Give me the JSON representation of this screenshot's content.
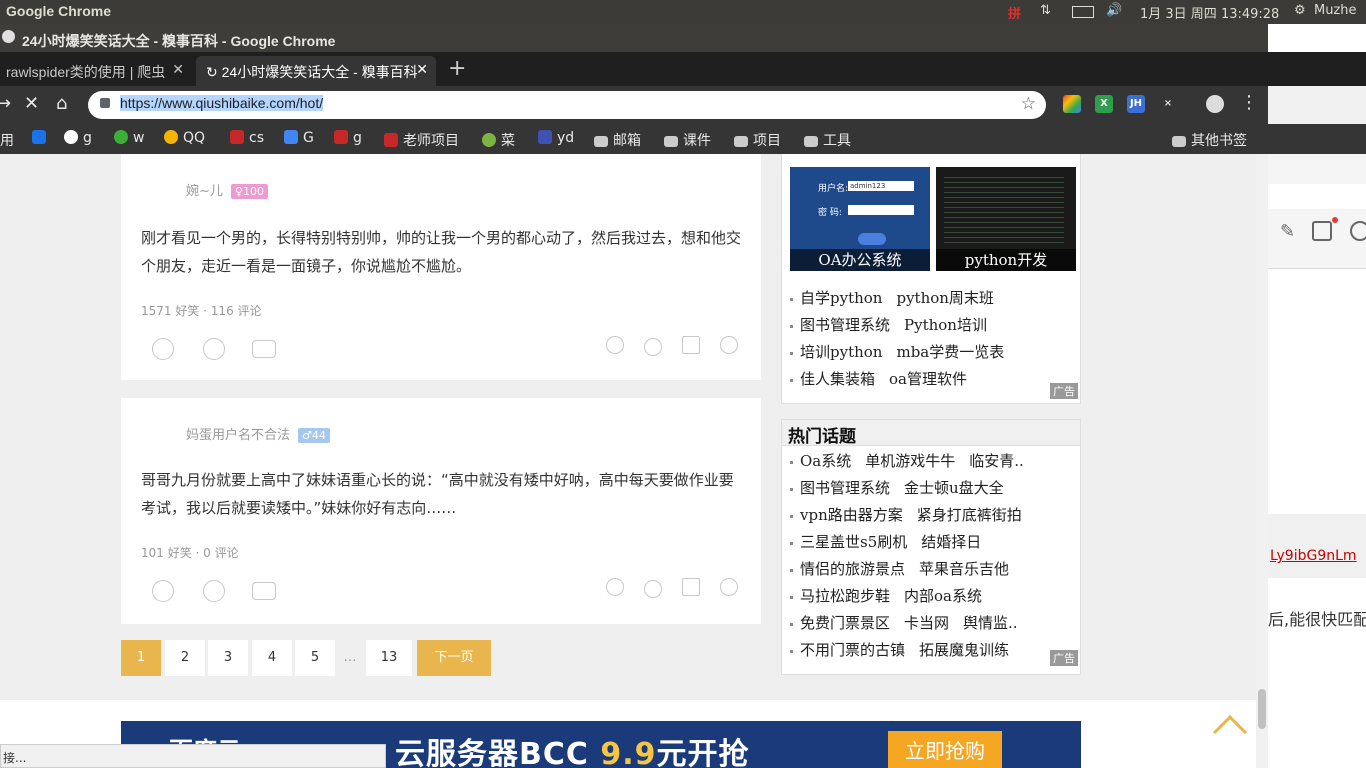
{
  "system": {
    "app": "Google Chrome",
    "ime": "拼",
    "clock": "1月 3日 周四 13:49:28",
    "user": "Muzhe"
  },
  "window": {
    "title": "24小时爆笑笑话大全 - 糗事百科 - Google Chrome"
  },
  "tabs": [
    {
      "label": "rawlspider类的使用 | 爬虫"
    },
    {
      "label": "24小时爆笑笑话大全 - 糗事百科"
    }
  ],
  "address": {
    "url": "https://www.qiushibaike.com/hot/"
  },
  "extensions": [
    "JH"
  ],
  "bookmarks": [
    "用",
    "g",
    "w",
    "QQ",
    "cs",
    "G",
    "g",
    "老师项目",
    "菜",
    "yd",
    "邮箱",
    "课件",
    "项目",
    "工具"
  ],
  "other_bookmarks": "其他书签",
  "posts": [
    {
      "author": "婉~儿",
      "badge": "♀100",
      "text": "刚才看见一个男的，长得特别特别帅，帅的让我一个男的都心动了，然后我过去，想和他交个朋友，走近一看是一面镜子，你说尴尬不尴尬。",
      "stats": "1571 好笑 · 116 评论"
    },
    {
      "author": "妈蛋用户名不合法",
      "badge": "♂44",
      "text": "哥哥九月份就要上高中了妹妹语重心长的说：“高中就没有矮中好呐，高中每天要做作业要考试，我以后就要读矮中。”妹妹你好有志向……",
      "stats": "101 好笑 · 0 评论"
    }
  ],
  "pagination": {
    "pages": [
      "1",
      "2",
      "3",
      "4",
      "5",
      "13"
    ],
    "ellipsis": "…",
    "next": "下一页"
  },
  "ad1": {
    "images": [
      {
        "caption": "OA办公系统",
        "login_user": "用户名:",
        "login_pwd": "密 码:",
        "username_value": "admin123"
      },
      {
        "caption": "python开发"
      }
    ],
    "links": [
      [
        "自学python",
        "python周末班"
      ],
      [
        "图书管理系统",
        "Python培训"
      ],
      [
        "培训python",
        "mba学费一览表"
      ],
      [
        "佳人集装箱",
        "oa管理软件"
      ]
    ],
    "tag": "广告"
  },
  "hot": {
    "title": "热门话题",
    "links": [
      [
        "Oa系统",
        "单机游戏牛牛",
        "临安青.."
      ],
      [
        "图书管理系统",
        "金士顿u盘大全"
      ],
      [
        "vpn路由器方案",
        "紧身打底裤街拍"
      ],
      [
        "三星盖世s5刷机",
        "结婚择日"
      ],
      [
        "情侣的旅游景点",
        "苹果音乐吉他"
      ],
      [
        "马拉松跑步鞋",
        "内部oa系统"
      ],
      [
        "免费门票景区",
        "卡当网",
        "舆情监.."
      ],
      [
        "不用门票的古镇",
        "拓展魔鬼训练"
      ]
    ],
    "tag": "广告"
  },
  "banner": {
    "logo": "百度云",
    "text_a": "云服务器BCC ",
    "text_price": "9.9",
    "text_b": "元开抢",
    "button": "立即抢购"
  },
  "status": "接...",
  "right_window": {
    "link_text": "Ly9ibG9nLm",
    "body_text": "后,能很快匹配"
  }
}
